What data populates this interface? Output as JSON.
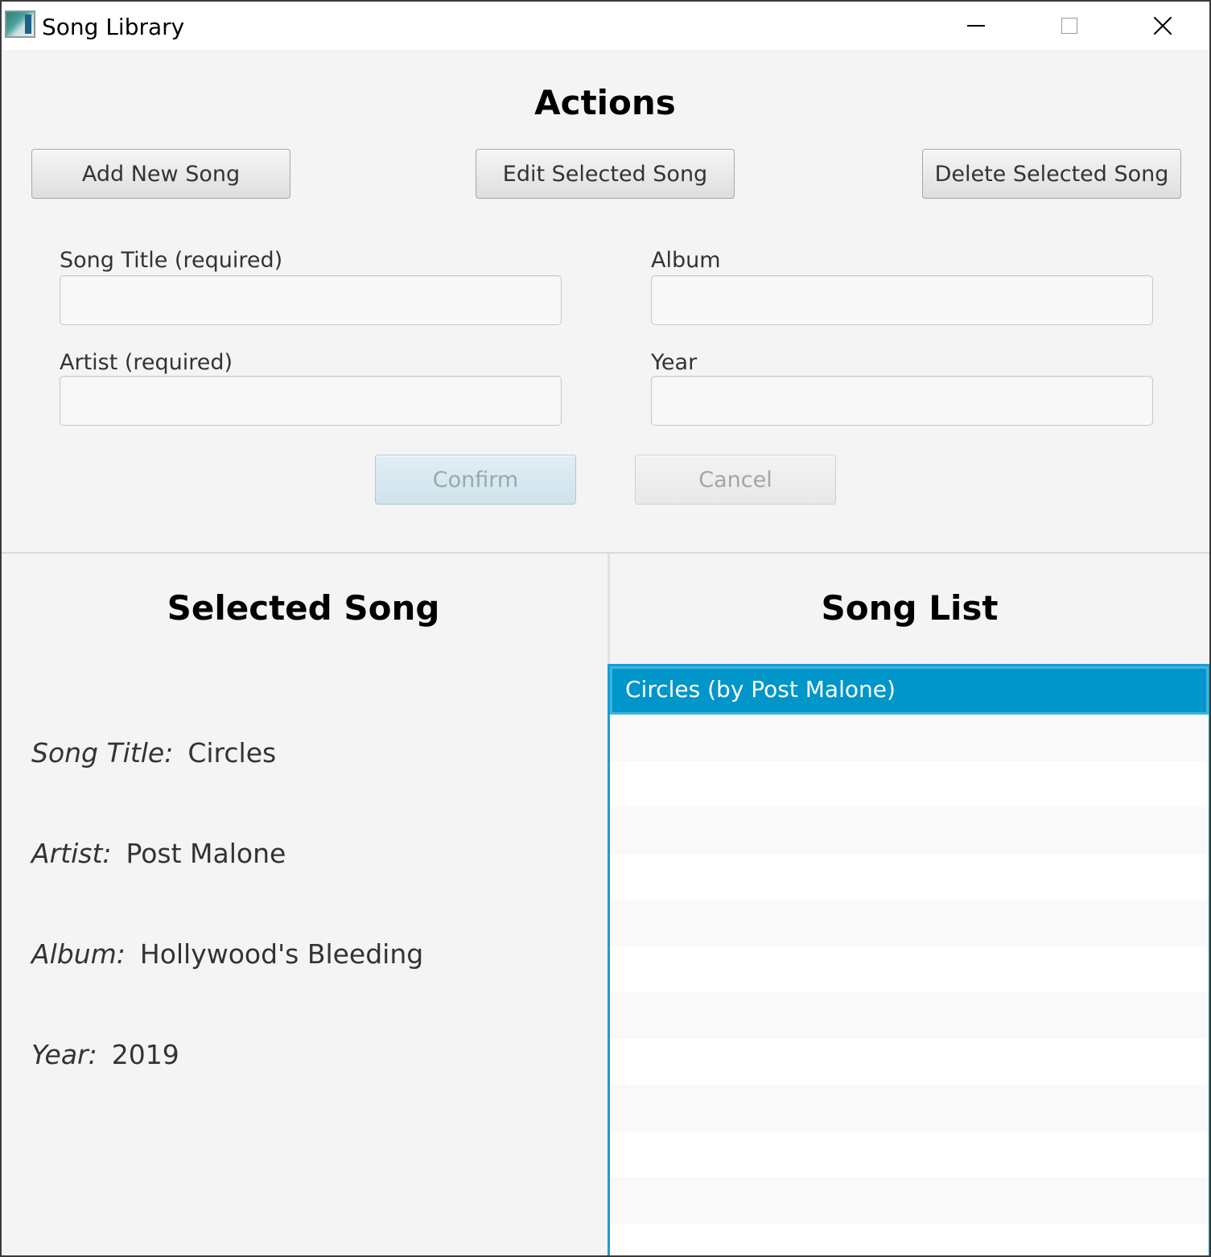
{
  "window": {
    "title": "Song Library"
  },
  "actions": {
    "heading": "Actions",
    "add_label": "Add New Song",
    "edit_label": "Edit Selected Song",
    "delete_label": "Delete Selected Song"
  },
  "form": {
    "title_label": "Song Title (required)",
    "album_label": "Album",
    "artist_label": "Artist (required)",
    "year_label": "Year",
    "title_value": "",
    "album_value": "",
    "artist_value": "",
    "year_value": "",
    "confirm_label": "Confirm",
    "cancel_label": "Cancel"
  },
  "selected": {
    "heading": "Selected Song",
    "title_key": "Song Title:",
    "title_value": "Circles",
    "artist_key": "Artist:",
    "artist_value": "Post Malone",
    "album_key": "Album:",
    "album_value": "Hollywood's Bleeding",
    "year_key": "Year:",
    "year_value": "2019"
  },
  "song_list": {
    "heading": "Song List",
    "items": [
      "Circles (by Post Malone)"
    ],
    "selected_index": 0
  },
  "colors": {
    "selection": "#0096c9",
    "list_border": "#1f9bcf"
  }
}
